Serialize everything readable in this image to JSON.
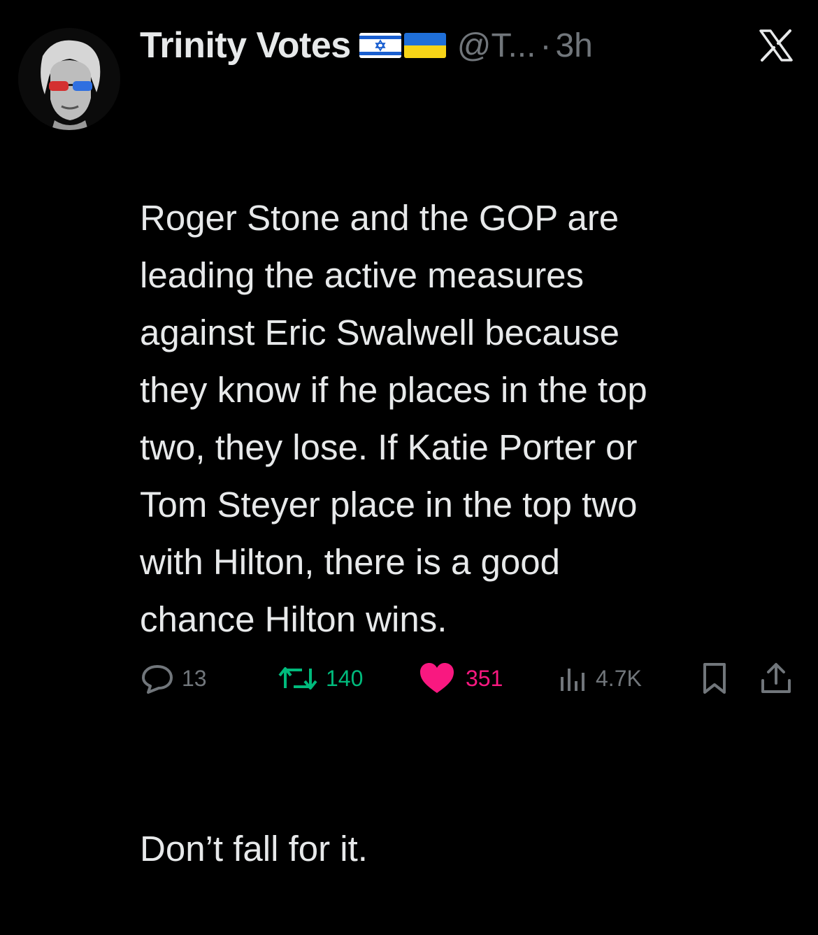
{
  "author": {
    "display_name": "Trinity Votes",
    "handle": "@T...",
    "separator": "·",
    "time": "3h",
    "flags": [
      "israel-flag",
      "ukraine-flag"
    ]
  },
  "platform": {
    "logo": "x-logo-icon"
  },
  "tweet": {
    "paragraph_1": "Roger Stone and the GOP are\nleading the active measures\nagainst Eric Swalwell because\nthey know if he places in the top\ntwo, they lose. If Katie Porter or\nTom Steyer place in the top two\nwith Hilton, there is a good\nchance Hilton wins.",
    "paragraph_2": "Don’t fall for it."
  },
  "actions": {
    "reply": {
      "icon": "reply-icon",
      "count": "13"
    },
    "retweet": {
      "icon": "retweet-icon",
      "count": "140",
      "color": "#00ba7c",
      "active": true
    },
    "like": {
      "icon": "heart-icon",
      "count": "351",
      "color": "#f91880",
      "active": true
    },
    "views": {
      "icon": "views-icon",
      "count": "4.7K"
    },
    "bookmark": {
      "icon": "bookmark-icon"
    },
    "share": {
      "icon": "share-icon"
    }
  },
  "colors": {
    "background": "#000000",
    "text_primary": "#e7e9ea",
    "text_secondary": "#71767b"
  }
}
